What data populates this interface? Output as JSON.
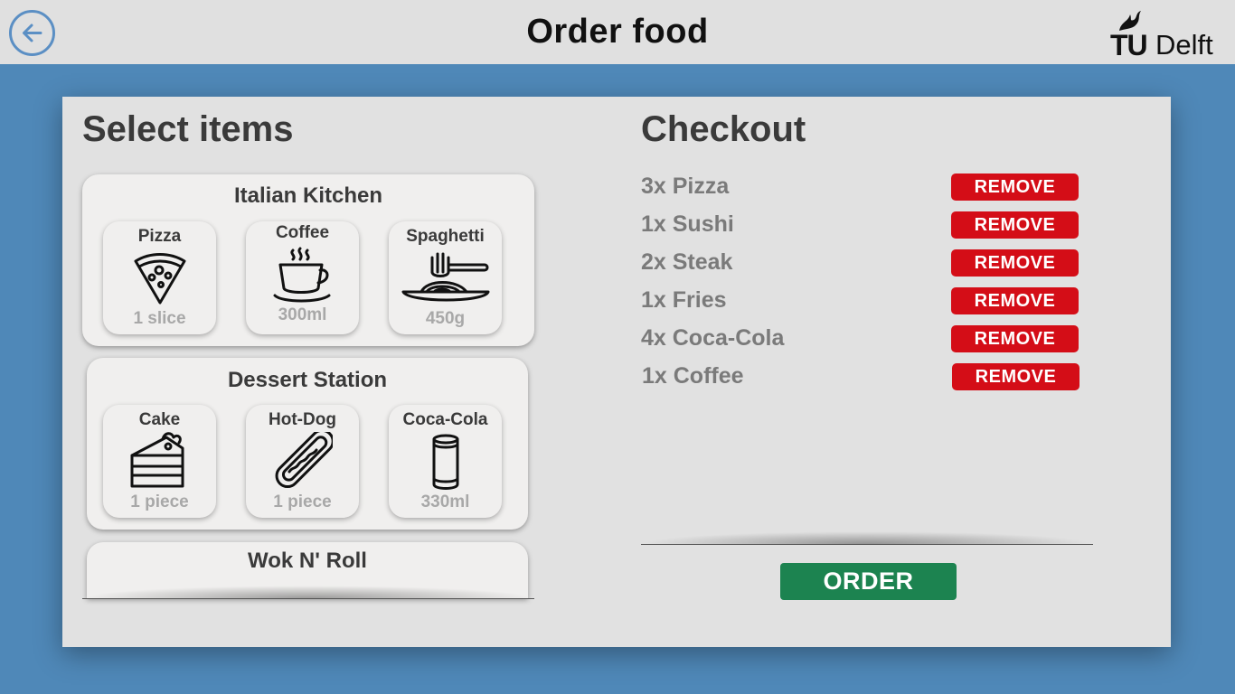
{
  "header": {
    "title": "Order food",
    "back_icon": "back-arrow-icon",
    "logo": {
      "text_tu": "TU",
      "text_delft": "Delft"
    }
  },
  "select": {
    "title": "Select items",
    "restaurants": [
      {
        "name": "Italian Kitchen",
        "items": [
          {
            "name": "Pizza",
            "size": "1 slice",
            "icon": "pizza-icon"
          },
          {
            "name": "Coffee",
            "size": "300ml",
            "icon": "coffee-icon"
          },
          {
            "name": "Spaghetti",
            "size": "450g",
            "icon": "spaghetti-icon"
          }
        ]
      },
      {
        "name": "Dessert Station",
        "items": [
          {
            "name": "Cake",
            "size": "1 piece",
            "icon": "cake-icon"
          },
          {
            "name": "Hot-Dog",
            "size": "1 piece",
            "icon": "hotdog-icon"
          },
          {
            "name": "Coca-Cola",
            "size": "330ml",
            "icon": "soda-can-icon"
          }
        ]
      },
      {
        "name": "Wok N' Roll",
        "items": []
      }
    ]
  },
  "checkout": {
    "title": "Checkout",
    "remove_label": "REMOVE",
    "items": [
      {
        "label": "3x Pizza"
      },
      {
        "label": "1x Sushi"
      },
      {
        "label": "2x Steak"
      },
      {
        "label": "1x Fries"
      },
      {
        "label": "4x Coca-Cola"
      },
      {
        "label": "1x Coffee"
      }
    ],
    "order_label": "ORDER"
  },
  "colors": {
    "background": "#4f88b8",
    "remove": "#d40d17",
    "order": "#1c8350"
  }
}
